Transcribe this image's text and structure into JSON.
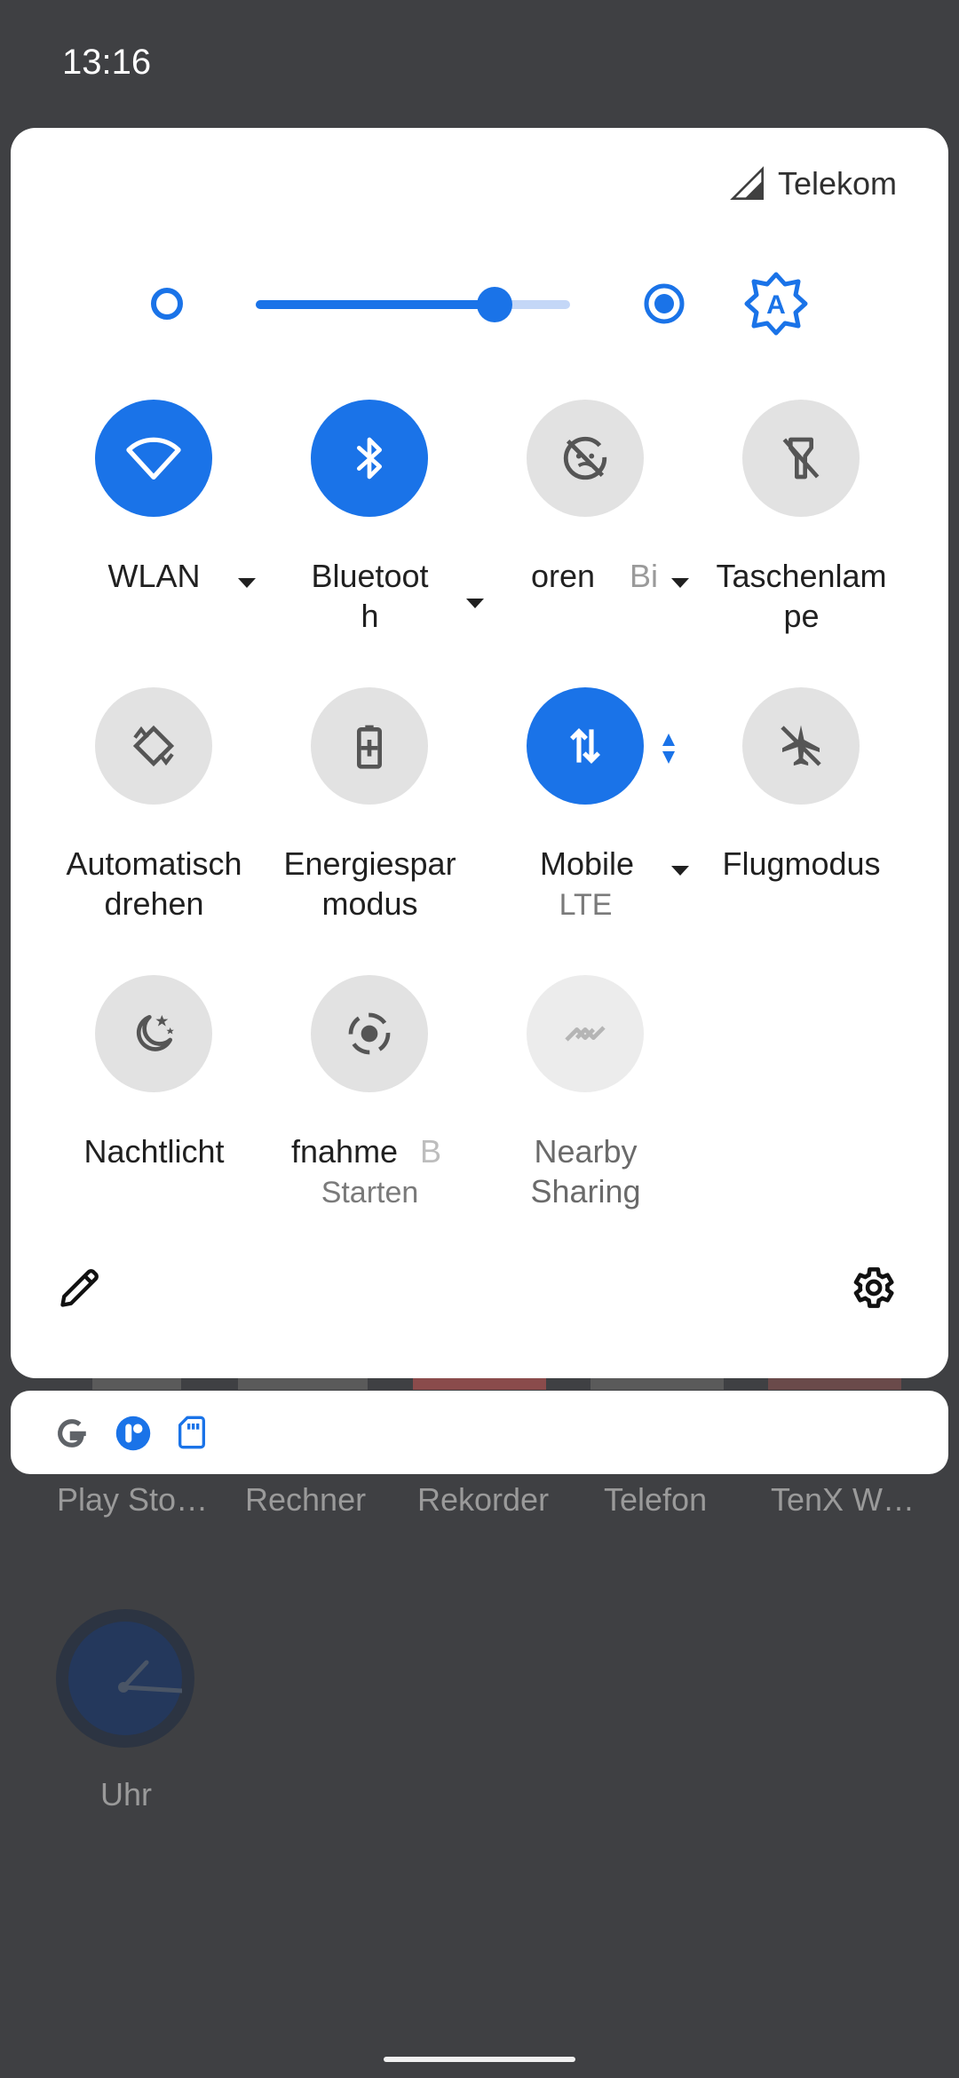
{
  "status_bar": {
    "time": "13:16"
  },
  "quick_settings": {
    "carrier": "Telekom",
    "brightness_level": 0.76,
    "tiles": [
      {
        "label": "WLAN",
        "state": "on",
        "icon": "wifi-icon"
      },
      {
        "label": "Bluetoot",
        "label2": "h",
        "state": "on",
        "icon": "bluetooth-icon"
      },
      {
        "label": "oren",
        "label_b": "Bi",
        "state": "off",
        "icon": "focus-mode-icon"
      },
      {
        "label": "Taschenlam",
        "label2": "pe",
        "state": "off",
        "icon": "flashlight-icon"
      },
      {
        "label": "Automatisch",
        "label2": "drehen",
        "state": "off",
        "icon": "auto-rotate-icon"
      },
      {
        "label": "Energiespar",
        "label2": "modus",
        "state": "off",
        "icon": "battery-saver-icon"
      },
      {
        "label": "Mobile",
        "sub": "LTE",
        "state": "on",
        "icon": "mobile-data-icon"
      },
      {
        "label": "Flugmodus",
        "state": "off",
        "icon": "airplane-mode-icon"
      },
      {
        "label": "Nachtlicht",
        "state": "off",
        "icon": "night-light-icon"
      },
      {
        "label": "fnahme",
        "label_b": "B",
        "sub": "Starten",
        "state": "off",
        "icon": "screen-record-icon"
      },
      {
        "label": "Nearby",
        "label2": "Sharing",
        "state": "unavailable",
        "icon": "nearby-share-icon"
      }
    ]
  },
  "background_apps": {
    "labels": [
      "Play Sto…",
      "Rechner",
      "Rekorder",
      "Telefon",
      "TenX W…"
    ],
    "clock_label": "Uhr"
  },
  "colors": {
    "accent": "#1a73e8",
    "tile_off": "#e2e2e2",
    "scrim": "#3f4043"
  }
}
